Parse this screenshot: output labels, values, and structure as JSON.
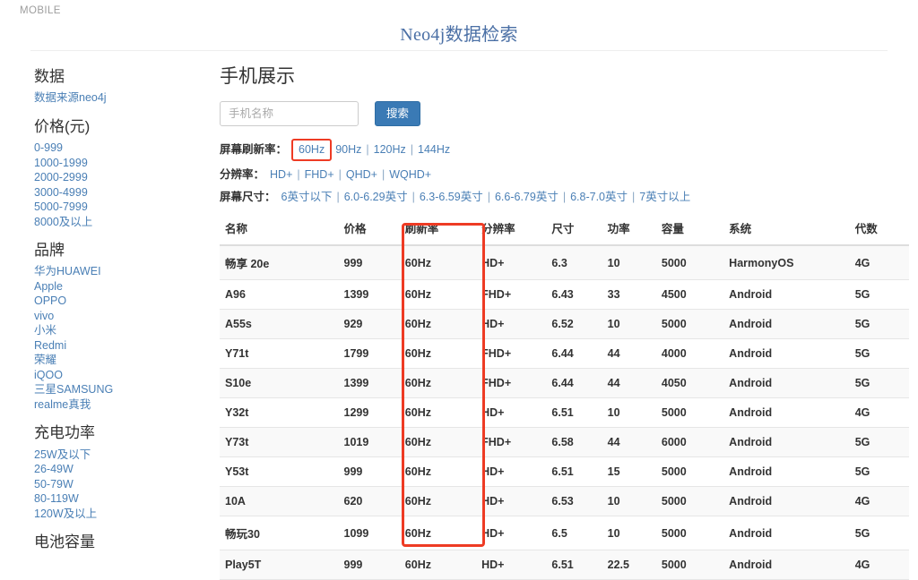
{
  "navbar": {
    "brand": "MOBILE"
  },
  "header": {
    "title": "Neo4j数据检索"
  },
  "sidebar": {
    "groups": [
      {
        "heading": "数据",
        "links": [
          "数据来源neo4j"
        ]
      },
      {
        "heading": "价格(元)",
        "links": [
          "0-999",
          "1000-1999",
          "2000-2999",
          "3000-4999",
          "5000-7999",
          "8000及以上"
        ]
      },
      {
        "heading": "品牌",
        "links": [
          "华为HUAWEI",
          "Apple",
          "OPPO",
          "vivo",
          "小米",
          "Redmi",
          "荣耀",
          "iQOO",
          "三星SAMSUNG",
          "realme真我"
        ]
      },
      {
        "heading": "充电功率",
        "links": [
          "25W及以下",
          "26-49W",
          "50-79W",
          "80-119W",
          "120W及以上"
        ]
      },
      {
        "heading": "电池容量",
        "links": []
      }
    ]
  },
  "main": {
    "heading": "手机展示",
    "search": {
      "placeholder": "手机名称",
      "value": "",
      "button_label": "搜索"
    },
    "filters": [
      {
        "label": "屏幕刷新率：",
        "options": [
          "60Hz",
          "90Hz",
          "120Hz",
          "144Hz"
        ],
        "selected": "60Hz"
      },
      {
        "label": "分辨率：",
        "options": [
          "HD+",
          "FHD+",
          "QHD+",
          "WQHD+"
        ],
        "selected": ""
      },
      {
        "label": "屏幕尺寸：",
        "options": [
          "6英寸以下",
          "6.0-6.29英寸",
          "6.3-6.59英寸",
          "6.6-6.79英寸",
          "6.8-7.0英寸",
          "7英寸以上"
        ],
        "selected": ""
      }
    ],
    "table": {
      "columns": [
        "名称",
        "价格",
        "刷新率",
        "分辨率",
        "尺寸",
        "功率",
        "容量",
        "系统",
        "代数"
      ],
      "rows": [
        [
          "畅享 20e",
          "999",
          "60Hz",
          "HD+",
          "6.3",
          "10",
          "5000",
          "HarmonyOS",
          "4G"
        ],
        [
          "A96",
          "1399",
          "60Hz",
          "FHD+",
          "6.43",
          "33",
          "4500",
          "Android",
          "5G"
        ],
        [
          "A55s",
          "929",
          "60Hz",
          "HD+",
          "6.52",
          "10",
          "5000",
          "Android",
          "5G"
        ],
        [
          "Y71t",
          "1799",
          "60Hz",
          "FHD+",
          "6.44",
          "44",
          "4000",
          "Android",
          "5G"
        ],
        [
          "S10e",
          "1399",
          "60Hz",
          "FHD+",
          "6.44",
          "44",
          "4050",
          "Android",
          "5G"
        ],
        [
          "Y32t",
          "1299",
          "60Hz",
          "HD+",
          "6.51",
          "10",
          "5000",
          "Android",
          "4G"
        ],
        [
          "Y73t",
          "1019",
          "60Hz",
          "FHD+",
          "6.58",
          "44",
          "6000",
          "Android",
          "5G"
        ],
        [
          "Y53t",
          "999",
          "60Hz",
          "HD+",
          "6.51",
          "15",
          "5000",
          "Android",
          "5G"
        ],
        [
          "10A",
          "620",
          "60Hz",
          "HD+",
          "6.53",
          "10",
          "5000",
          "Android",
          "4G"
        ],
        [
          "畅玩30",
          "1099",
          "60Hz",
          "HD+",
          "6.5",
          "10",
          "5000",
          "Android",
          "5G"
        ],
        [
          "Play5T",
          "999",
          "60Hz",
          "HD+",
          "6.51",
          "22.5",
          "5000",
          "Android",
          "4G"
        ]
      ]
    }
  },
  "annotations": {
    "highlight_color": "#ee3b24",
    "refresh_rate_column_box": true
  }
}
